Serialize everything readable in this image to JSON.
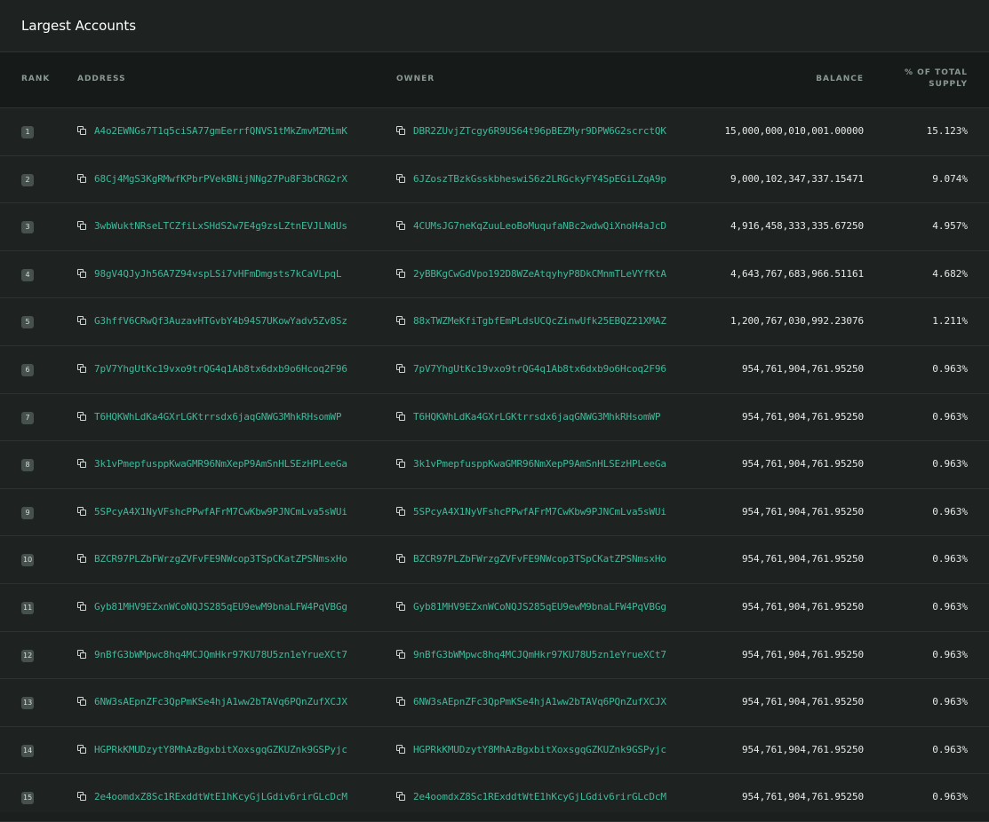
{
  "title": "Largest Accounts",
  "headers": {
    "rank": "RANK",
    "address": "ADDRESS",
    "owner": "OWNER",
    "balance": "BALANCE",
    "pct_line1": "% OF TOTAL",
    "pct_line2": "SUPPLY"
  },
  "icons": {
    "copy": "copy-icon"
  },
  "colors": {
    "link": "#3fb89a",
    "background": "#1e2322",
    "header": "#161a19"
  },
  "rows": [
    {
      "rank": "1",
      "address": "A4o2EWNGs7T1q5ciSA77gmEerrfQNVS1tMkZmvMZMimK",
      "owner": "DBR2ZUvjZTcgy6R9US64t96pBEZMyr9DPW6G2scrctQK",
      "balance": "15,000,000,010,001.00000",
      "pct": "15.123%"
    },
    {
      "rank": "2",
      "address": "68Cj4MgS3KgRMwfKPbrPVekBNijNNg27Pu8F3bCRG2rX",
      "owner": "6JZoszTBzkGsskbheswiS6z2LRGckyFY4SpEGiLZqA9p",
      "balance": "9,000,102,347,337.15471",
      "pct": "9.074%"
    },
    {
      "rank": "3",
      "address": "3wbWuktNRseLTCZfiLxSHdS2w7E4g9zsLZtnEVJLNdUs",
      "owner": "4CUMsJG7neKqZuuLeoBoMuqufaNBc2wdwQiXnoH4aJcD",
      "balance": "4,916,458,333,335.67250",
      "pct": "4.957%"
    },
    {
      "rank": "4",
      "address": "98gV4QJyJh56A7Z94vspLSi7vHFmDmgsts7kCaVLpqL",
      "owner": "2yBBKgCwGdVpo192D8WZeAtqyhyP8DkCMnmTLeVYfKtA",
      "balance": "4,643,767,683,966.51161",
      "pct": "4.682%"
    },
    {
      "rank": "5",
      "address": "G3hffV6CRwQf3AuzavHTGvbY4b94S7UKowYadv5Zv8Sz",
      "owner": "88xTWZMeKfiTgbfEmPLdsUCQcZinwUfk25EBQZ21XMAZ",
      "balance": "1,200,767,030,992.23076",
      "pct": "1.211%"
    },
    {
      "rank": "6",
      "address": "7pV7YhgUtKc19vxo9trQG4q1Ab8tx6dxb9o6Hcoq2F96",
      "owner": "7pV7YhgUtKc19vxo9trQG4q1Ab8tx6dxb9o6Hcoq2F96",
      "balance": "954,761,904,761.95250",
      "pct": "0.963%"
    },
    {
      "rank": "7",
      "address": "T6HQKWhLdKa4GXrLGKtrrsdx6jaqGNWG3MhkRHsomWP",
      "owner": "T6HQKWhLdKa4GXrLGKtrrsdx6jaqGNWG3MhkRHsomWP",
      "balance": "954,761,904,761.95250",
      "pct": "0.963%"
    },
    {
      "rank": "8",
      "address": "3k1vPmepfusppKwaGMR96NmXepP9AmSnHLSEzHPLeeGa",
      "owner": "3k1vPmepfusppKwaGMR96NmXepP9AmSnHLSEzHPLeeGa",
      "balance": "954,761,904,761.95250",
      "pct": "0.963%"
    },
    {
      "rank": "9",
      "address": "5SPcyA4X1NyVFshcPPwfAFrM7CwKbw9PJNCmLva5sWUi",
      "owner": "5SPcyA4X1NyVFshcPPwfAFrM7CwKbw9PJNCmLva5sWUi",
      "balance": "954,761,904,761.95250",
      "pct": "0.963%"
    },
    {
      "rank": "10",
      "address": "BZCR97PLZbFWrzgZVFvFE9NWcop3TSpCKatZPSNmsxHo",
      "owner": "BZCR97PLZbFWrzgZVFvFE9NWcop3TSpCKatZPSNmsxHo",
      "balance": "954,761,904,761.95250",
      "pct": "0.963%"
    },
    {
      "rank": "11",
      "address": "Gyb81MHV9EZxnWCoNQJS285qEU9ewM9bnaLFW4PqVBGg",
      "owner": "Gyb81MHV9EZxnWCoNQJS285qEU9ewM9bnaLFW4PqVBGg",
      "balance": "954,761,904,761.95250",
      "pct": "0.963%"
    },
    {
      "rank": "12",
      "address": "9nBfG3bWMpwc8hq4MCJQmHkr97KU78U5zn1eYrueXCt7",
      "owner": "9nBfG3bWMpwc8hq4MCJQmHkr97KU78U5zn1eYrueXCt7",
      "balance": "954,761,904,761.95250",
      "pct": "0.963%"
    },
    {
      "rank": "13",
      "address": "6NW3sAEpnZFc3QpPmKSe4hjA1ww2bTAVq6PQnZufXCJX",
      "owner": "6NW3sAEpnZFc3QpPmKSe4hjA1ww2bTAVq6PQnZufXCJX",
      "balance": "954,761,904,761.95250",
      "pct": "0.963%"
    },
    {
      "rank": "14",
      "address": "HGPRkKMUDzytY8MhAzBgxbitXoxsgqGZKUZnk9GSPyjc",
      "owner": "HGPRkKMUDzytY8MhAzBgxbitXoxsgqGZKUZnk9GSPyjc",
      "balance": "954,761,904,761.95250",
      "pct": "0.963%"
    },
    {
      "rank": "15",
      "address": "2e4oomdxZ8Sc1RExddtWtE1hKcyGjLGdiv6rirGLcDcM",
      "owner": "2e4oomdxZ8Sc1RExddtWtE1hKcyGjLGdiv6rirGLcDcM",
      "balance": "954,761,904,761.95250",
      "pct": "0.963%"
    }
  ]
}
